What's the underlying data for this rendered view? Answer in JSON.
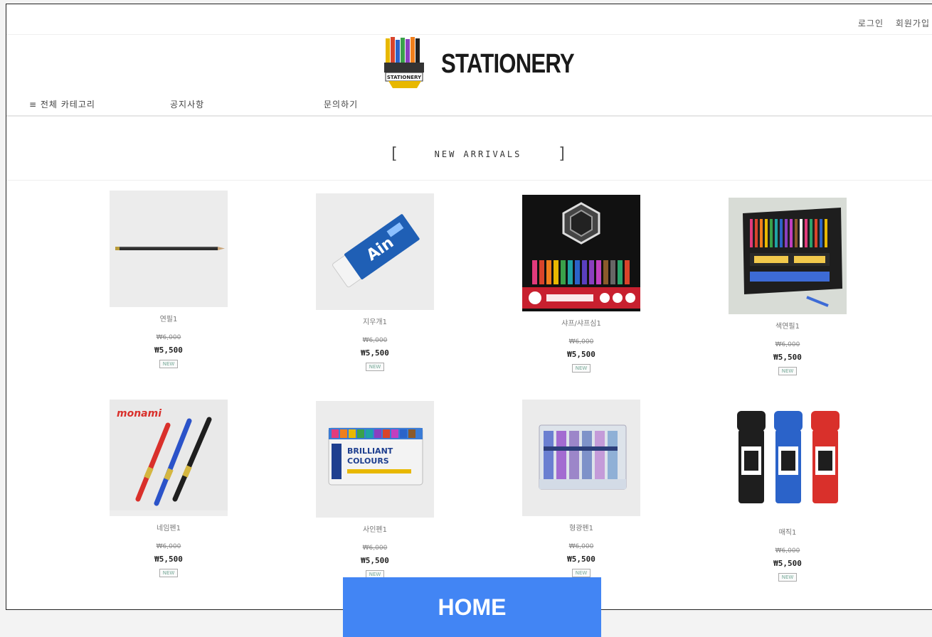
{
  "auth": {
    "login": "로그인",
    "signup": "회원가입"
  },
  "brand": {
    "name": "STATIONERY",
    "badge_text": "STATIONERY"
  },
  "nav": {
    "all_categories": "≡ 전체 카테고리",
    "notice": "공지사항",
    "inquiry": "문의하기"
  },
  "section": {
    "open": "[",
    "title": "NEW ARRIVALS",
    "close": "]"
  },
  "products": [
    {
      "name": "연필1",
      "original_price": "₩6,000",
      "price": "₩5,500",
      "badge": "NEW",
      "image": "pencil"
    },
    {
      "name": "지우개1",
      "original_price": "₩6,000",
      "price": "₩5,500",
      "badge": "NEW",
      "image": "eraser"
    },
    {
      "name": "샤프/샤프심1",
      "original_price": "₩6,000",
      "price": "₩5,500",
      "badge": "NEW",
      "image": "graphite-pencil-set"
    },
    {
      "name": "색연필1",
      "original_price": "₩6,000",
      "price": "₩5,500",
      "badge": "NEW",
      "image": "colored-pencil-set"
    },
    {
      "name": "네임펜1",
      "original_price": "₩6,000",
      "price": "₩5,500",
      "badge": "NEW",
      "image": "name-pens"
    },
    {
      "name": "사인펜1",
      "original_price": "₩6,000",
      "price": "₩5,500",
      "badge": "NEW",
      "image": "sign-pen-set"
    },
    {
      "name": "형광펜1",
      "original_price": "₩6,000",
      "price": "₩5,500",
      "badge": "NEW",
      "image": "highlighter-set"
    },
    {
      "name": "매직1",
      "original_price": "₩6,000",
      "price": "₩5,500",
      "badge": "NEW",
      "image": "markers"
    }
  ],
  "home_button": "HOME",
  "colors": {
    "home_button": "#4285f4",
    "text": "#333333"
  }
}
